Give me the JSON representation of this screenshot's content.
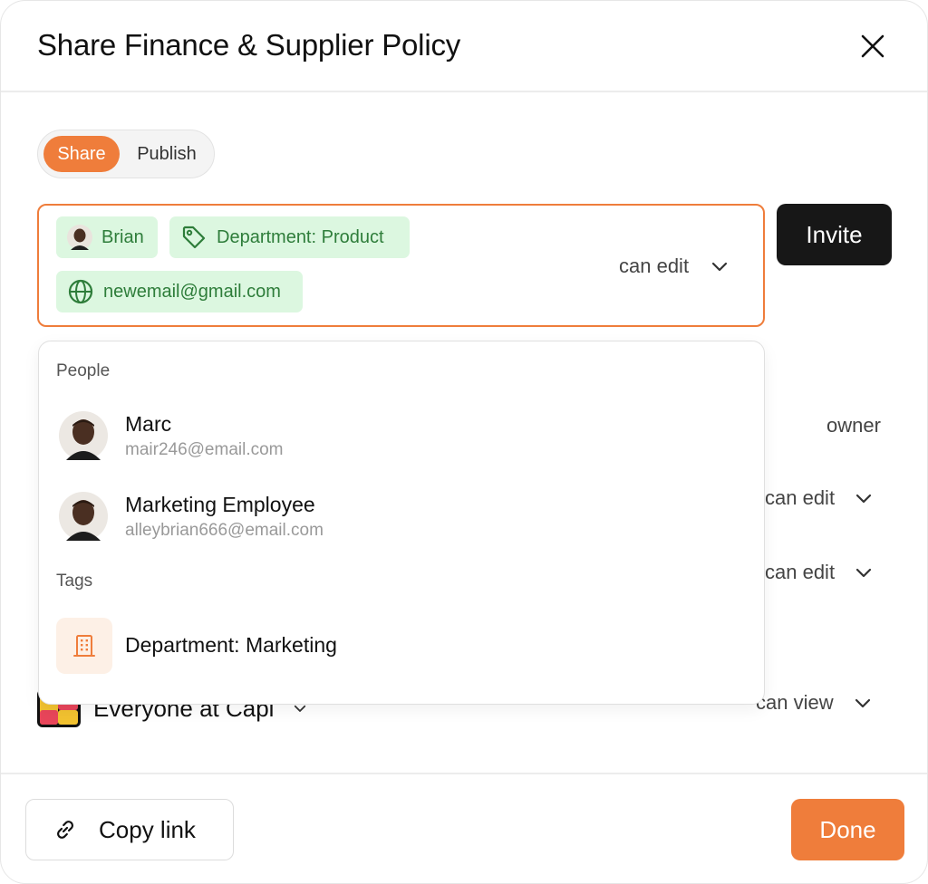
{
  "dialog": {
    "title": "Share Finance & Supplier Policy"
  },
  "mode_tabs": {
    "share": "Share",
    "publish": "Publish",
    "active": "Share"
  },
  "invite": {
    "chips": [
      {
        "label": "Brian",
        "icon": "avatar"
      },
      {
        "label": "Department: Product",
        "icon": "tag-icon"
      },
      {
        "label": "newemail@gmail.com",
        "icon": "globe-icon"
      }
    ],
    "permission": "can edit",
    "button_label": "Invite"
  },
  "suggestions": {
    "people_heading": "People",
    "people": [
      {
        "name": "Marc",
        "email": "mair246@email.com"
      },
      {
        "name": "Marketing Employee",
        "email": "alleybrian666@email.com"
      }
    ],
    "tags_heading": "Tags",
    "tags": [
      {
        "label": "Department: Marketing",
        "icon": "building-icon"
      }
    ]
  },
  "members_background": {
    "rows": [
      {
        "permission": "owner"
      },
      {
        "permission": "can edit"
      },
      {
        "permission": "can edit"
      }
    ],
    "everyone": {
      "label": "Everyone at Capi",
      "permission": "can view"
    }
  },
  "footer": {
    "copy_link": "Copy link",
    "done": "Done"
  },
  "colors": {
    "accent": "#ef7d3b",
    "chip_bg": "#dcf7e0",
    "chip_text": "#2e7d3a",
    "invite_bg": "#171717"
  }
}
